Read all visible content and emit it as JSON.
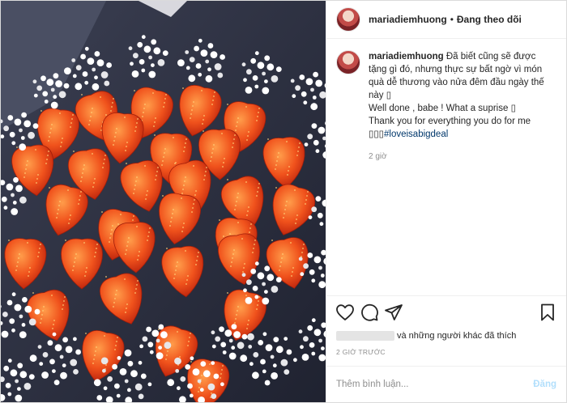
{
  "header": {
    "username": "mariadiemhuong",
    "separator": "•",
    "follow_status": "Đang theo dõi"
  },
  "caption": {
    "username": "mariadiemhuong",
    "text_1": "Đã biết cũng sẽ được tặng gì đó, nhưng thực sự bất ngờ vì món quà dễ thương vào nửa đêm đầu ngày thế này ",
    "text_2": "Well done , babe ! What a suprise ",
    "text_3": "Thank you for everything you do for me ",
    "hashtag": "#loveisabigdeal",
    "time": "2 giờ"
  },
  "actions": {
    "like_icon": "heart-icon",
    "comment_icon": "comment-icon",
    "share_icon": "share-icon",
    "save_icon": "bookmark-icon"
  },
  "likes": {
    "text": "và những người khác đã thích"
  },
  "timestamp": "2 GIỜ TRƯỚC",
  "comment_box": {
    "placeholder": "Thêm bình luận...",
    "post_label": "Đăng"
  },
  "colors": {
    "link": "#00376b",
    "muted": "#8e8e8e",
    "post_button": "#b2dffc"
  }
}
